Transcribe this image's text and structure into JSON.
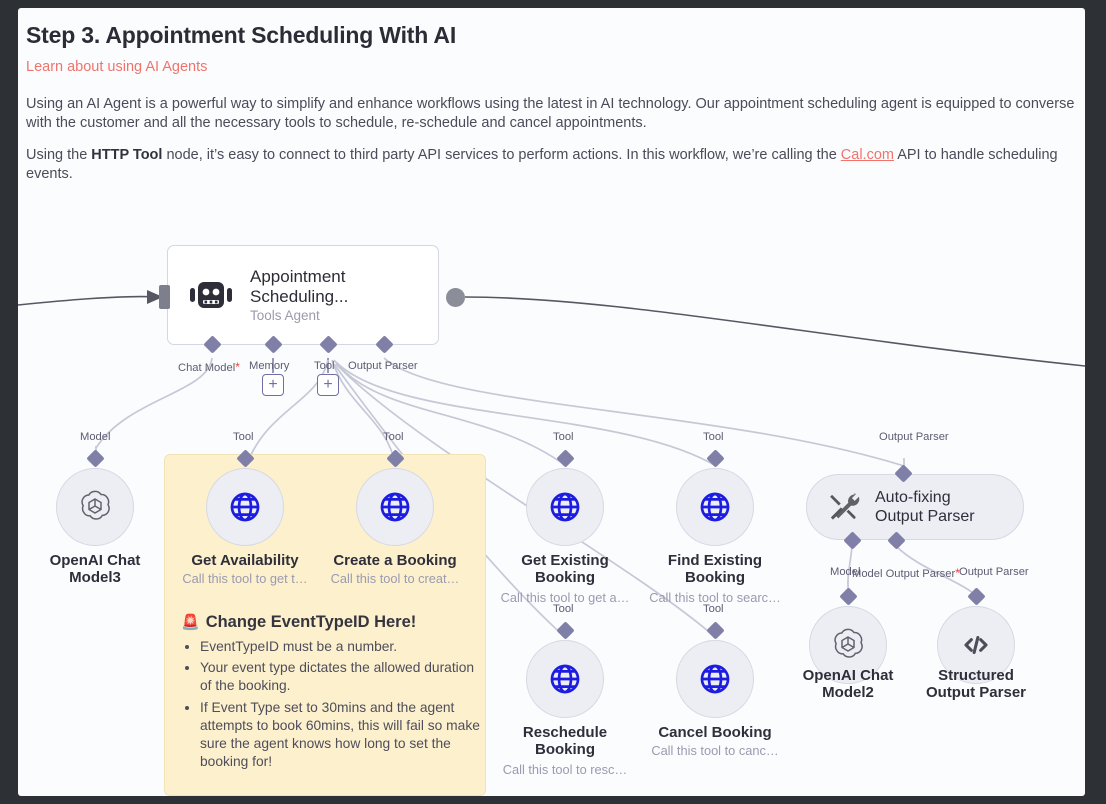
{
  "document": {
    "title": "Step 3. Appointment Scheduling With AI",
    "link": "Learn about using AI Agents",
    "paragraph1": "Using an AI Agent is a powerful way to simplify and enhance workflows using the latest in AI technology. Our appointment scheduling agent is equipped to converse with the customer and all the necessary tools to schedule, re-schedule and cancel appointments.",
    "paragraph2_part1": "Using the ",
    "paragraph2_bold": "HTTP Tool",
    "paragraph2_part2": " node, it’s easy to connect to third party API services to perform actions. In this workflow, we’re calling the ",
    "paragraph2_link": "Cal.com",
    "paragraph2_part3": " API to handle scheduling events."
  },
  "sticky_note": {
    "emoji": "🚨",
    "heading": "Change EventTypeID Here!",
    "bullets": [
      "EventTypeID must be a number.",
      "Your event type dictates the allowed duration of the booking.",
      "If Event Type set to 30mins and the agent attempts to book 60mins, this will fail so make sure the agent knows how long to set the booking for!"
    ]
  },
  "agent_node": {
    "icon": "robot-icon",
    "title": "Appointment Scheduling...",
    "subtitle": "Tools Agent",
    "ports": [
      {
        "label": "Chat Model",
        "required": true
      },
      {
        "label": "Memory",
        "required": false
      },
      {
        "label": "Tool",
        "required": false
      },
      {
        "label": "Output Parser",
        "required": false
      }
    ]
  },
  "nodes": [
    {
      "id": "openai-chat-model3",
      "icon": "openai-icon",
      "caption": "OpenAI Chat Model3",
      "subtitle": "",
      "port_label": "Model"
    },
    {
      "id": "get-availability",
      "icon": "globe-icon",
      "caption": "Get Availability",
      "subtitle": "Call this tool to get t…",
      "port_label": "Tool"
    },
    {
      "id": "create-a-booking",
      "icon": "globe-icon",
      "caption": "Create a Booking",
      "subtitle": "Call this tool to creat…",
      "port_label": "Tool"
    },
    {
      "id": "get-existing-booking",
      "icon": "globe-icon",
      "caption": "Get Existing Booking",
      "subtitle": "Call this tool to get a…",
      "port_label": "Tool"
    },
    {
      "id": "find-existing-booking",
      "icon": "globe-icon",
      "caption": "Find Existing Booking",
      "subtitle": "Call this tool to searc…",
      "port_label": "Tool"
    },
    {
      "id": "reschedule-booking",
      "icon": "globe-icon",
      "caption": "Reschedule Booking",
      "subtitle": "Call this tool to resc…",
      "port_label": "Tool"
    },
    {
      "id": "cancel-booking",
      "icon": "globe-icon",
      "caption": "Cancel Booking",
      "subtitle": "Call this tool to canc…",
      "port_label": "Tool"
    },
    {
      "id": "openai-chat-model2",
      "icon": "openai-icon",
      "caption": "OpenAI Chat Model2",
      "subtitle": "",
      "port_label": "Model"
    },
    {
      "id": "structured-output-parser",
      "icon": "code-icon",
      "caption": "Structured Output Parser",
      "subtitle": "",
      "port_label": "Output Parser"
    }
  ],
  "autofix_node": {
    "icon": "tools-icon",
    "label": "Auto-fixing Output Parser",
    "top_port_label": "Output Parser",
    "bottom_port_labels": [
      "Model",
      "Model Output Parser",
      "Output Parser"
    ],
    "bottom_required_marker": "*"
  },
  "colors": {
    "frame": "#2d3035",
    "canvas": "#fbfcfe",
    "accent_red": "#f0746c",
    "sticky_yellow": "#fdf0cd",
    "node_fill": "#eceef4",
    "node_border": "#d6d8e3",
    "port_diamond": "#7f7fa8",
    "globe_blue": "#1d1de0",
    "edge": "#c6c8d6",
    "main_edge": "#555862"
  }
}
